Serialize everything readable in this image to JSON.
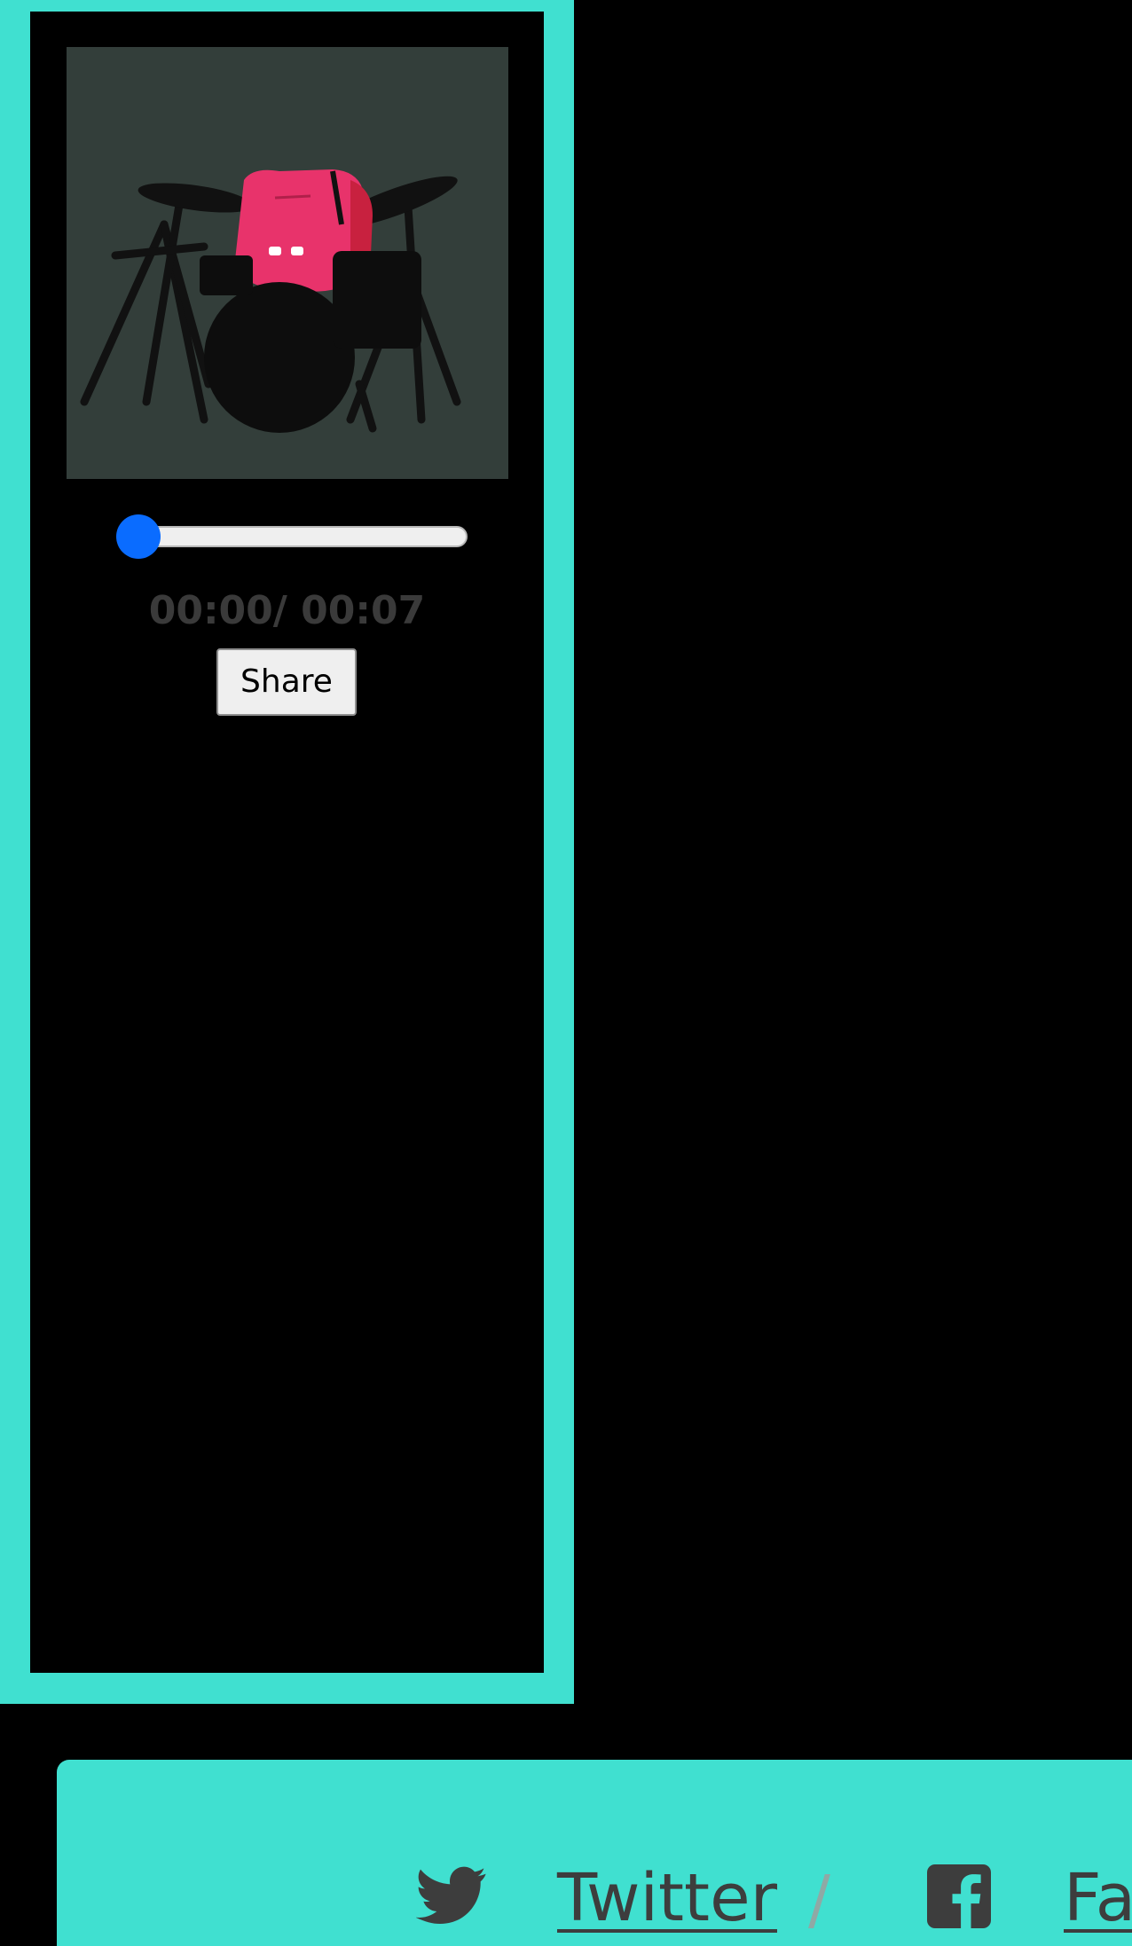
{
  "player": {
    "artwork_alt": "monster-drummer-artwork",
    "progress": 0,
    "time_readout": "00:00/ 00:07",
    "share_label": "Share"
  },
  "footer": {
    "links": [
      {
        "label": "Twitter",
        "icon": "twitter-icon"
      },
      {
        "label": "Fa",
        "icon": "facebook-icon"
      }
    ],
    "separator": "/"
  },
  "colors": {
    "accent": "#40e0d0",
    "background": "#000000",
    "artwork_bg": "#333e3a",
    "monster": "#e8336b",
    "slider_thumb": "#0a6cff",
    "text_muted": "#3a3a3a",
    "link_text": "#3d3d3d"
  }
}
